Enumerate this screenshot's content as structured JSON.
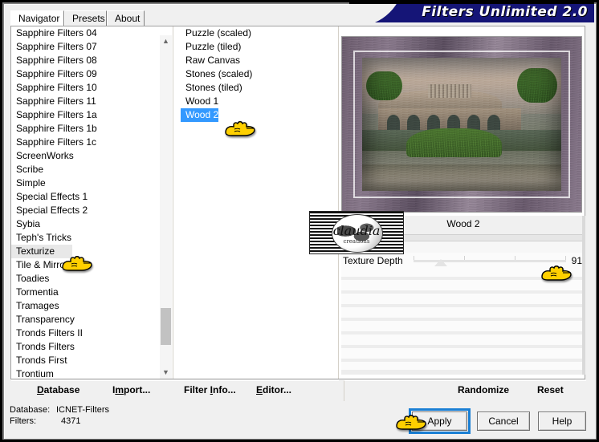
{
  "window": {
    "title": "Filters Unlimited 2.0"
  },
  "tabs": [
    {
      "label": "Navigator",
      "active": true
    },
    {
      "label": "Presets",
      "active": false
    },
    {
      "label": "About",
      "active": false
    }
  ],
  "category_list": {
    "items": [
      {
        "label": "Sapphire Filters 04"
      },
      {
        "label": "Sapphire Filters 07"
      },
      {
        "label": "Sapphire Filters 08"
      },
      {
        "label": "Sapphire Filters 09"
      },
      {
        "label": "Sapphire Filters 10"
      },
      {
        "label": "Sapphire Filters 11"
      },
      {
        "label": "Sapphire Filters 1a"
      },
      {
        "label": "Sapphire Filters 1b"
      },
      {
        "label": "Sapphire Filters 1c"
      },
      {
        "label": "ScreenWorks"
      },
      {
        "label": "Scribe"
      },
      {
        "label": "Simple"
      },
      {
        "label": "Special Effects 1"
      },
      {
        "label": "Special Effects 2"
      },
      {
        "label": "Sybia"
      },
      {
        "label": "Teph's Tricks"
      },
      {
        "label": "Texturize"
      },
      {
        "label": "Tile & Mirror"
      },
      {
        "label": "Toadies"
      },
      {
        "label": "Tormentia"
      },
      {
        "label": "Tramages"
      },
      {
        "label": "Transparency"
      },
      {
        "label": "Tronds Filters II"
      },
      {
        "label": "Tronds Filters"
      },
      {
        "label": "Tronds First"
      },
      {
        "label": "Trontium"
      }
    ],
    "selected": "Texturize",
    "scroll_up_icon": "chevron-up-icon",
    "scroll_down_icon": "chevron-down-icon"
  },
  "effect_list": {
    "items": [
      {
        "label": "Puzzle (scaled)"
      },
      {
        "label": "Puzzle (tiled)"
      },
      {
        "label": "Raw Canvas"
      },
      {
        "label": "Stones (scaled)"
      },
      {
        "label": "Stones (tiled)"
      },
      {
        "label": "Wood 1"
      },
      {
        "label": "Wood 2"
      }
    ],
    "selected": "Wood 2"
  },
  "preview": {
    "alt": "wood-textured framed landscape photo of an arched stone bridge"
  },
  "watermark": {
    "name": "claudia",
    "sub": "creations"
  },
  "params": {
    "title": "Wood 2",
    "slider": {
      "label": "Texture Depth",
      "value": "91"
    }
  },
  "links": [
    {
      "label": "Database",
      "accel": "D"
    },
    {
      "label": "Import...",
      "accel": "m"
    },
    {
      "label": "Filter Info...",
      "accel": "I"
    },
    {
      "label": "Editor...",
      "accel": "E"
    }
  ],
  "right_links": [
    {
      "label": "Randomize"
    },
    {
      "label": "Reset"
    }
  ],
  "status": {
    "database_label": "Database:",
    "database_value": "ICNET-Filters",
    "filters_label": "Filters:",
    "filters_value": "4371"
  },
  "buttons": {
    "apply": "Apply",
    "cancel": "Cancel",
    "help": "Help"
  },
  "colors": {
    "title_bar": "#151577",
    "selection": "#3399ff",
    "focus_ring": "#1a7fd4",
    "cursor_hand": "#ffd000"
  }
}
